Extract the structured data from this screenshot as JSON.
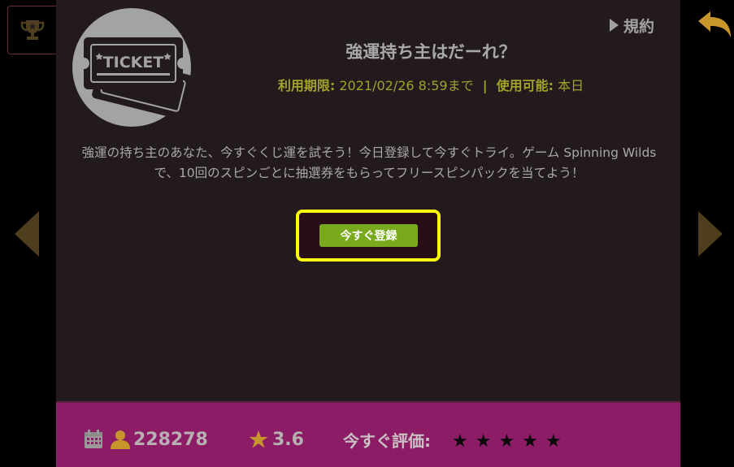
{
  "header": {
    "terms_label": "規約"
  },
  "offer": {
    "ticket_text": "TICKET",
    "title": "強運持ち主はだーれ？",
    "expiry_label": "利用期限:",
    "expiry_value": "2021/02/26 8:59まで",
    "separator": "|",
    "usable_label": "使用可能:",
    "usable_value": "本日",
    "description": "強運の持ち主のあなた、今すぐくじ運を試そう！今日登録して今すぐトライ。ゲーム Spinning Wildsで、10回のスピンごとに抽選券をもらってフリースピンパックを当てよう！",
    "cta_label": "今すぐ登録"
  },
  "footer": {
    "user_count": "228278",
    "rating": "3.6",
    "rate_label": "今すぐ評価:",
    "rate_stars": [
      "★",
      "★",
      "★",
      "★",
      "★"
    ]
  },
  "colors": {
    "panel_bg": "#231a1e",
    "footer_bg": "#8d1c67",
    "accent_gold": "#a2a12c",
    "icon_gold": "#c8952c",
    "nav_arrow": "#4f3e1d",
    "cta_green": "#79aa1d",
    "highlight_yellow": "#fbfb0e"
  }
}
